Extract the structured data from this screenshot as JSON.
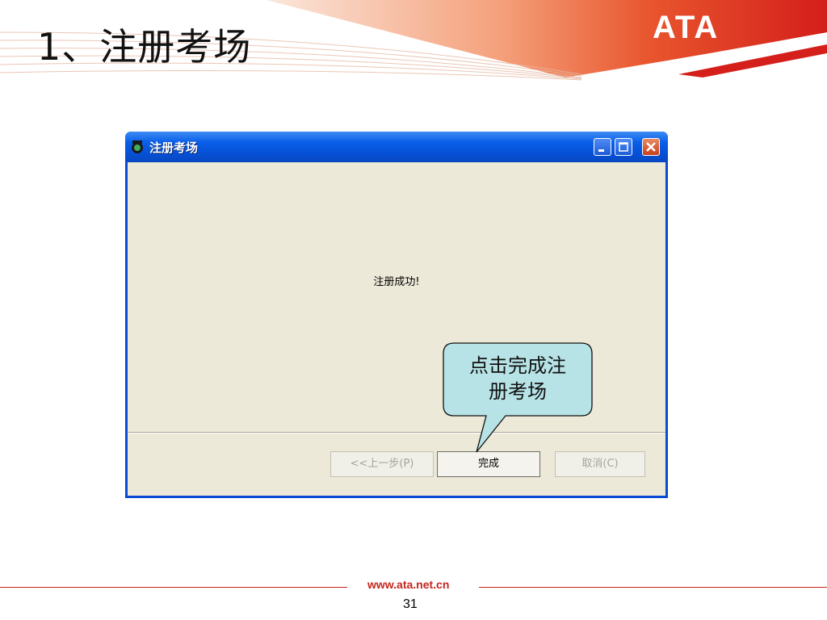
{
  "slide": {
    "title": "1、注册考场",
    "logo": "ATA",
    "footer_url": "www.ata.net.cn",
    "page_number": "31",
    "accent_color": "#c4261c"
  },
  "window": {
    "title": "注册考场",
    "icon": "app-icon",
    "title_buttons": [
      "minimize-icon",
      "maximize-icon",
      "close-icon"
    ],
    "message": "注册成功!",
    "buttons": {
      "prev": "<<上一步(P)",
      "finish": "完成",
      "cancel": "取消(C)"
    }
  },
  "callout": {
    "line1": "点击完成注",
    "line2": "册考场"
  }
}
